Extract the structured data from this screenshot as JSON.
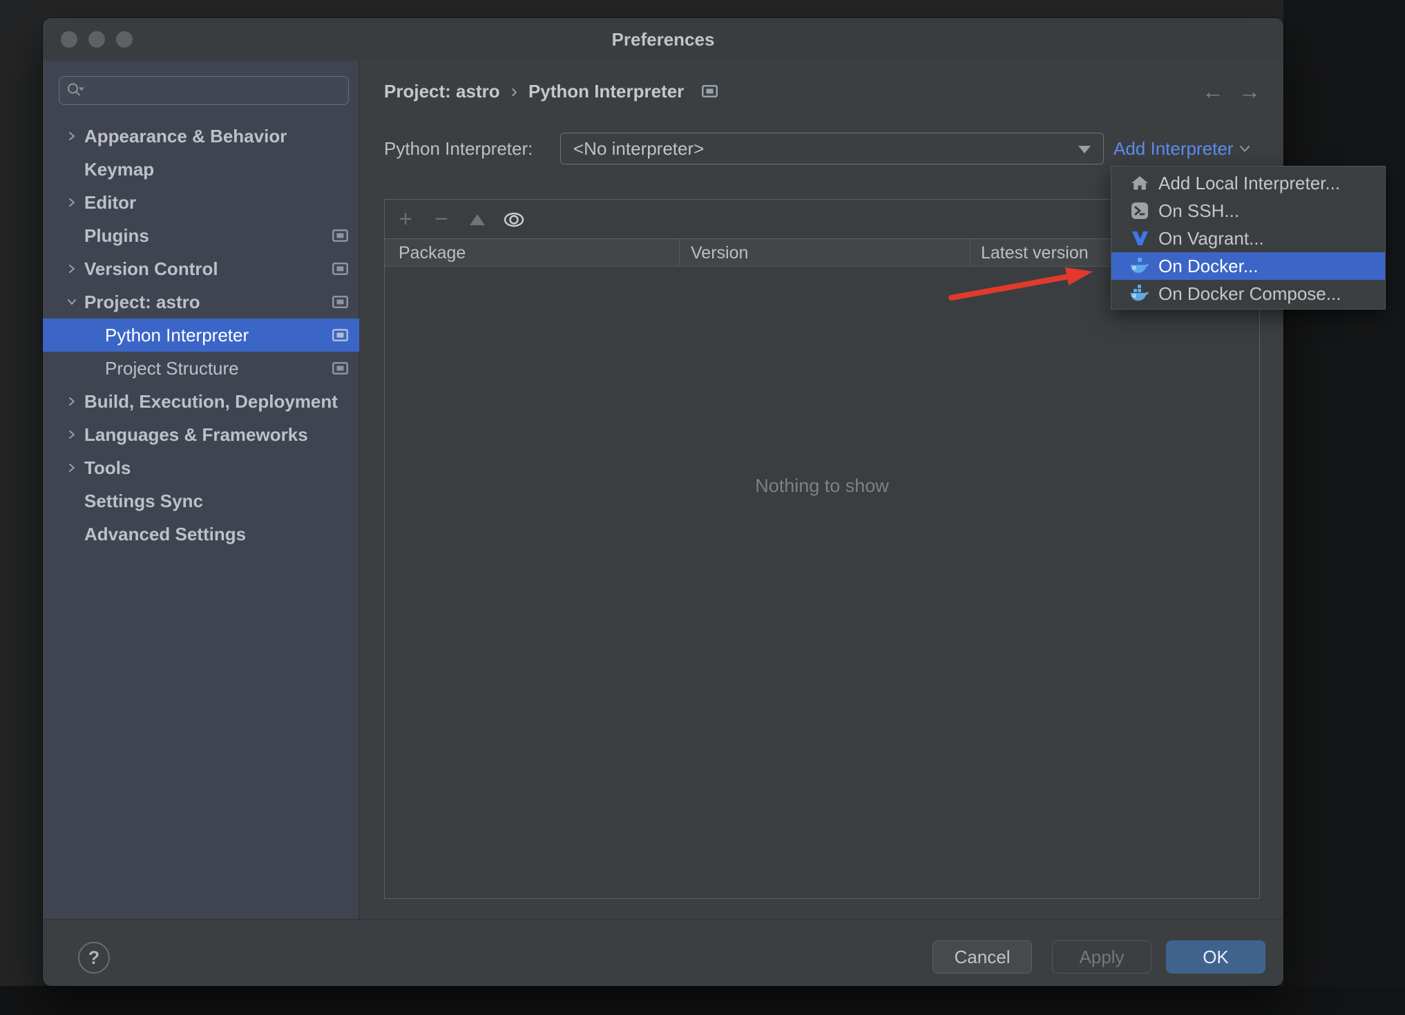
{
  "window": {
    "title": "Preferences"
  },
  "sidebar": {
    "items": [
      {
        "label": "Appearance & Behavior"
      },
      {
        "label": "Keymap"
      },
      {
        "label": "Editor"
      },
      {
        "label": "Plugins"
      },
      {
        "label": "Version Control"
      },
      {
        "label": "Project: astro"
      },
      {
        "label": "Python Interpreter",
        "selected": true
      },
      {
        "label": "Project Structure"
      },
      {
        "label": "Build, Execution, Deployment"
      },
      {
        "label": "Languages & Frameworks"
      },
      {
        "label": "Tools"
      },
      {
        "label": "Settings Sync"
      },
      {
        "label": "Advanced Settings"
      }
    ]
  },
  "breadcrumb": {
    "project": "Project: astro",
    "separator": "›",
    "page": "Python Interpreter"
  },
  "nav_arrows": {
    "back_glyph": "←",
    "forward_glyph": "→"
  },
  "interpreter": {
    "label": "Python Interpreter:",
    "value": "<No interpreter>",
    "add_link": "Add Interpreter"
  },
  "menu": {
    "items": [
      {
        "label": "Add Local Interpreter...",
        "icon": "home-icon"
      },
      {
        "label": "On SSH...",
        "icon": "ssh-terminal-icon"
      },
      {
        "label": "On Vagrant...",
        "icon": "vagrant-icon"
      },
      {
        "label": "On Docker...",
        "icon": "docker-whale-icon",
        "selected": true
      },
      {
        "label": "On Docker Compose...",
        "icon": "docker-compose-icon"
      }
    ]
  },
  "packages": {
    "toolbar": {
      "plus_glyph": "+",
      "minus_glyph": "−"
    },
    "columns": [
      "Package",
      "Version",
      "Latest version"
    ],
    "empty_text": "Nothing to show"
  },
  "footer": {
    "help_label": "?",
    "cancel_label": "Cancel",
    "apply_label": "Apply",
    "ok_label": "OK"
  },
  "colors": {
    "selection_blue": "#3b66c8",
    "link_blue": "#5b8df2",
    "ok_button_blue": "#40638e",
    "annotation_arrow_red": "#e13a2c",
    "docker_blue": "#5fa9e8",
    "vagrant_blue": "#3b79e8",
    "sidebar_bg": "#3f4450",
    "window_bg": "#3c3f41"
  }
}
